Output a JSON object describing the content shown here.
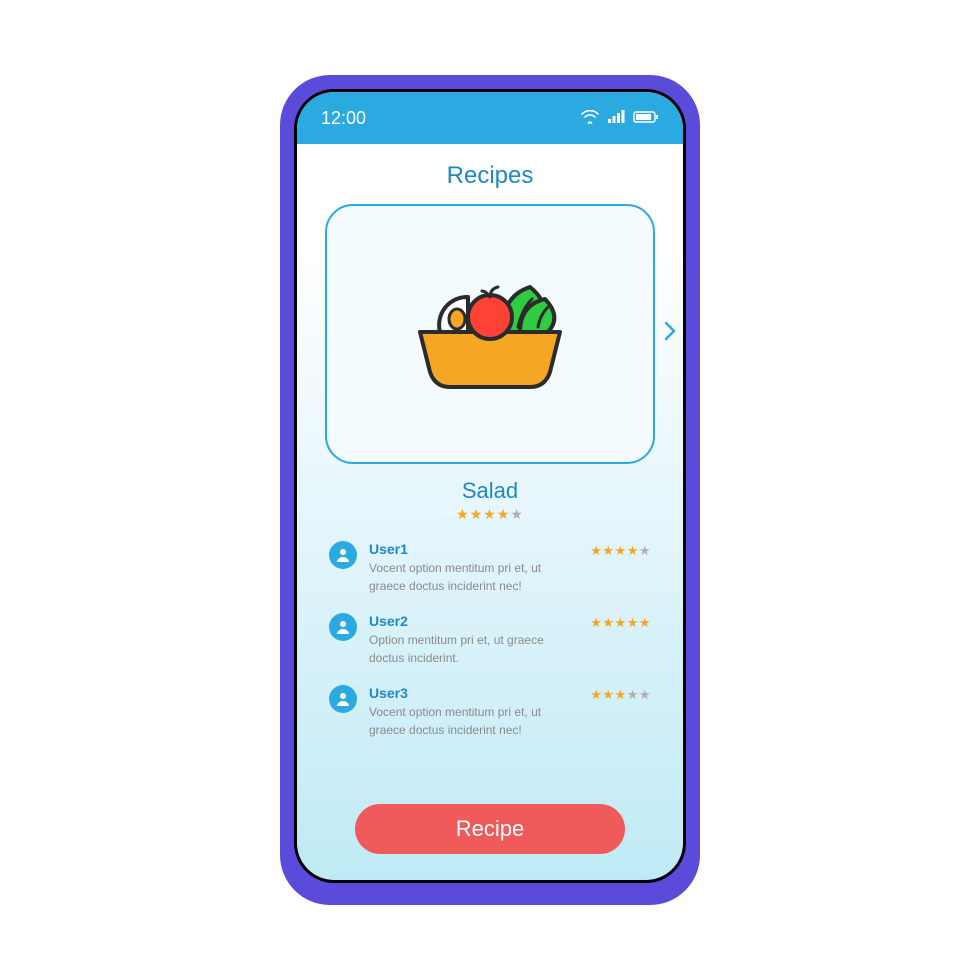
{
  "status": {
    "time": "12:00"
  },
  "page": {
    "title": "Recipes"
  },
  "dish": {
    "name": "Salad",
    "rating": 4,
    "max_rating": 5
  },
  "reviews": [
    {
      "user": "User1",
      "rating": 4,
      "text": "Vocent option mentitum pri et, ut graece doctus inciderint nec!"
    },
    {
      "user": "User2",
      "rating": 5,
      "text": "Option mentitum pri et, ut graece doctus inciderint."
    },
    {
      "user": "User3",
      "rating": 3,
      "text": "Vocent option mentitum pri et, ut graece doctus inciderint nec!"
    }
  ],
  "button": {
    "label": "Recipe"
  },
  "colors": {
    "accent": "#2ba9e1",
    "primary_text": "#1e88c7",
    "button": "#f05a5a",
    "frame": "#5b4bdb"
  }
}
